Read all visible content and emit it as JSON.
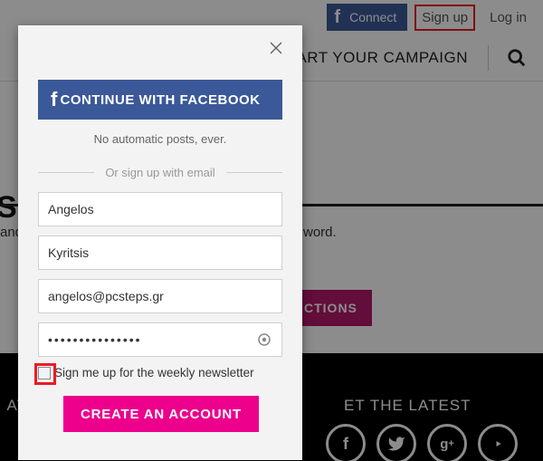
{
  "topnav": {
    "fb_connect": "Connect",
    "signup": "Sign up",
    "login": "Log in"
  },
  "subnav": {
    "campaign": "ART YOUR CAMPAIGN"
  },
  "background": {
    "heading_fragment": "S",
    "text_left_fragment": "and",
    "text_right_fragment": "word.",
    "button_fragment": "CTIONS",
    "latest_left_fragment": "AT",
    "latest": "ET THE LATEST"
  },
  "modal": {
    "fb_button": "CONTINUE WITH FACEBOOK",
    "no_auto": "No automatic posts, ever.",
    "or_email": "Or sign up with email",
    "first_name": "Angelos",
    "last_name": "Kyritsis",
    "email": "angelos@pcsteps.gr",
    "password_masked": "•••••••••••••••",
    "newsletter_label": "Sign me up for the weekly newsletter",
    "create_button": "CREATE AN ACCOUNT"
  }
}
